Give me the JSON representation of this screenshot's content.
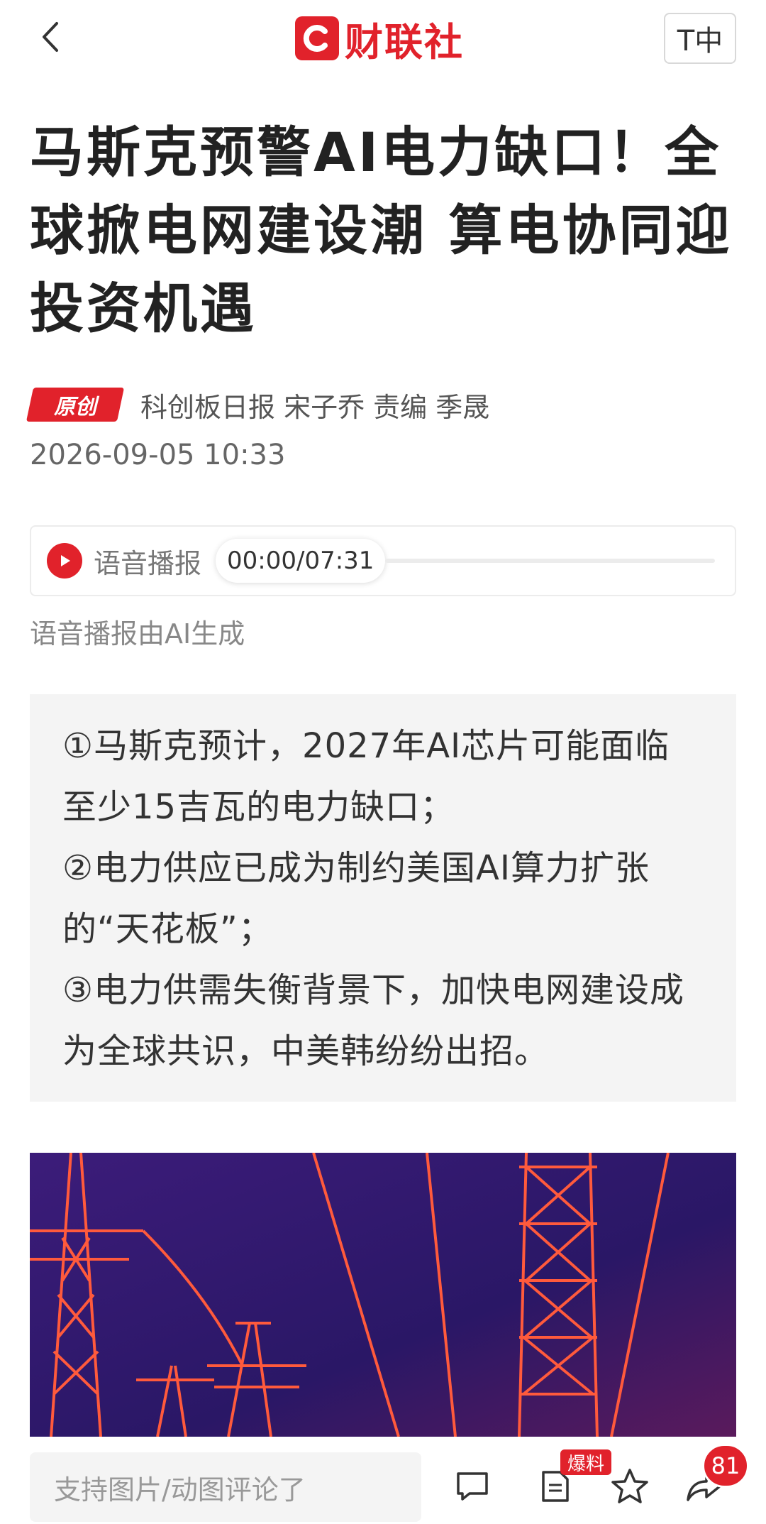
{
  "header": {
    "logo_text": "财联社",
    "font_toggle_label": "T中"
  },
  "article": {
    "title_part1": "马斯克预警",
    "title_ai": "AI",
    "title_part2": "电力缺口！全球掀电网建设潮 算电协同迎投资机遇",
    "badge": "原创",
    "byline": "科创板日报 宋子乔  责编 季晟",
    "date": "2026-09-05 10:33"
  },
  "audio": {
    "label": "语音播报",
    "time": "00:00/07:31",
    "progress": 0,
    "note": "语音播报由AI生成"
  },
  "summary": [
    "①马斯克预计，2027年AI芯片可能面临至少15吉瓦的电力缺口；",
    "②电力供应已成为制约美国AI算力扩张的“天花板”；",
    "③电力供需失衡背景下，加快电网建设成为全球共识，中美韩纷纷出招。"
  ],
  "bottom_bar": {
    "comment_placeholder": "支持图片/动图评论了",
    "tip_tag": "爆料",
    "comment_count": "81"
  },
  "colors": {
    "brand_red": "#e1222b",
    "hero_bg": "#3a1e78",
    "hero_tower": "#ff5a3c"
  }
}
